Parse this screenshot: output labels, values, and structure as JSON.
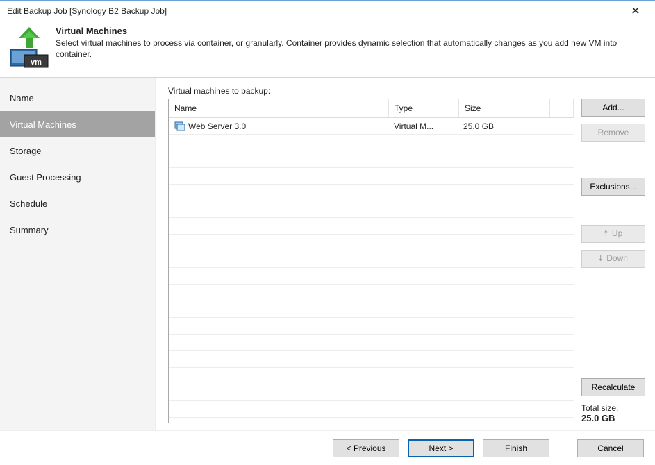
{
  "window": {
    "title": "Edit Backup Job [Synology B2 Backup Job]"
  },
  "header": {
    "heading": "Virtual Machines",
    "description": "Select virtual machines to process via container, or granularly. Container provides dynamic selection that automatically changes as you add new VM into container."
  },
  "nav": {
    "steps": [
      {
        "label": "Name"
      },
      {
        "label": "Virtual Machines"
      },
      {
        "label": "Storage"
      },
      {
        "label": "Guest Processing"
      },
      {
        "label": "Schedule"
      },
      {
        "label": "Summary"
      }
    ],
    "active_index": 1
  },
  "main": {
    "list_label": "Virtual machines to backup:",
    "columns": {
      "name": "Name",
      "type": "Type",
      "size": "Size"
    },
    "vms": [
      {
        "name": "Web Server 3.0",
        "type": "Virtual M...",
        "size": "25.0 GB"
      }
    ]
  },
  "side": {
    "add": "Add...",
    "remove": "Remove",
    "exclusions": "Exclusions...",
    "up": "Up",
    "down": "Down",
    "recalc": "Recalculate",
    "total_label": "Total size:",
    "total_value": "25.0 GB"
  },
  "footer": {
    "prev": "< Previous",
    "next": "Next >",
    "finish": "Finish",
    "cancel": "Cancel"
  }
}
